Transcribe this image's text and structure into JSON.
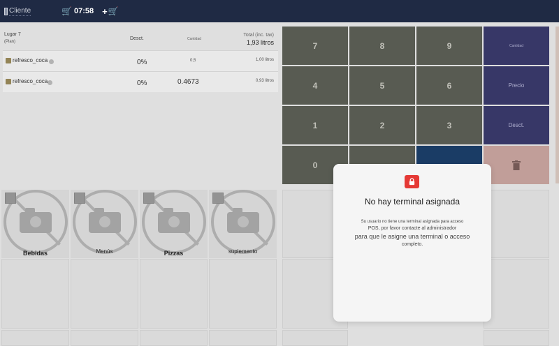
{
  "topbar": {
    "client_label": "Cliente",
    "time": "07:58",
    "add_icon": "add-cart-icon"
  },
  "ticket": {
    "header": {
      "place": "Lugar 7",
      "place_sub": "(Plan)",
      "discount": "Desct.",
      "quantity": "Cantidad",
      "total_label": "Total (inc. tax)",
      "total_value": "1,93 litros"
    },
    "rows": [
      {
        "name": "refresco_coca",
        "discount": "0%",
        "quantity": "0,5",
        "total": "1,00 litros"
      },
      {
        "name": "refresco_coca",
        "discount": "0%",
        "quantity": "0.4673",
        "total": "0,93 litros"
      }
    ]
  },
  "keypad": {
    "k7": "7",
    "k8": "8",
    "k9": "9",
    "k4": "4",
    "k5": "5",
    "k6": "6",
    "k1": "1",
    "k2": "2",
    "k3": "3",
    "k0": "0",
    "qty_label": "Cantidad",
    "price_label": "Precio",
    "discount_label": "Desct."
  },
  "categories": [
    {
      "label": "Bebidas"
    },
    {
      "label": "Menús"
    },
    {
      "label": "Pizzas"
    },
    {
      "label": "suplemento"
    }
  ],
  "modal": {
    "title": "No hay terminal asignada",
    "line1": "Su usuario no tiene una terminal asignada para acceso",
    "line2": "POS, por favor contacte al administrador",
    "line3": "para que le asigne una terminal o acceso",
    "line4": "completo."
  },
  "colors": {
    "topbar": "#1f2a44",
    "key": "#5c5f56",
    "func_key": "#3a3a6c",
    "lock": "#e53935"
  }
}
